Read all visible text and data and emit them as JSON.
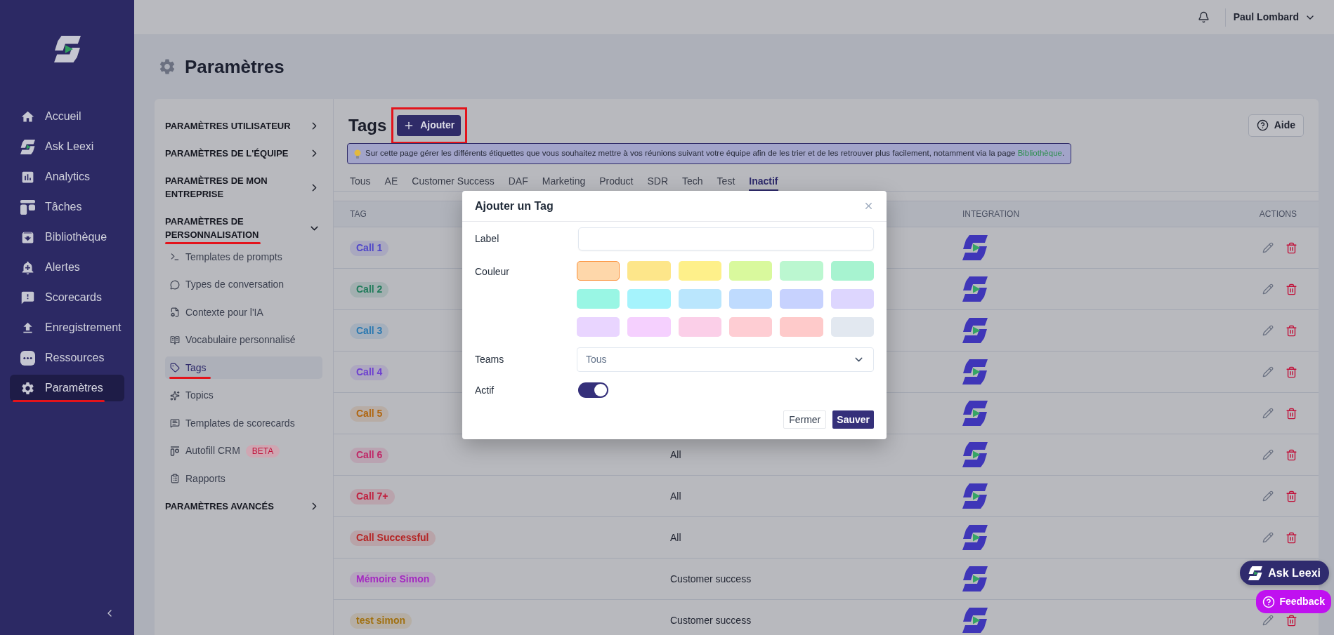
{
  "sidebar": {
    "items": [
      {
        "label": "Accueil",
        "selected": false,
        "highlighted": false
      },
      {
        "label": "Ask Leexi",
        "selected": false,
        "highlighted": false
      },
      {
        "label": "Analytics",
        "selected": false,
        "highlighted": false
      },
      {
        "label": "Tâches",
        "selected": false,
        "highlighted": false
      },
      {
        "label": "Bibliothèque",
        "selected": false,
        "highlighted": false
      },
      {
        "label": "Alertes",
        "selected": false,
        "highlighted": false
      },
      {
        "label": "Scorecards",
        "selected": false,
        "highlighted": false
      },
      {
        "label": "Enregistrement",
        "selected": false,
        "highlighted": false
      },
      {
        "label": "Ressources",
        "selected": false,
        "highlighted": false
      },
      {
        "label": "Paramètres",
        "selected": true,
        "highlighted": true
      }
    ]
  },
  "header": {
    "user_name": "Paul Lombard"
  },
  "page_title": "Paramètres",
  "settings_nav": {
    "sections": [
      {
        "label": "PARAMÈTRES UTILISATEUR",
        "expanded": false,
        "highlighted": false
      },
      {
        "label": "PARAMÈTRES DE L'ÉQUIPE",
        "expanded": false,
        "highlighted": false
      },
      {
        "label": "PARAMÈTRES DE MON ENTREPRISE",
        "expanded": false,
        "highlighted": false
      },
      {
        "label": "PARAMÈTRES DE PERSONNALISATION",
        "expanded": true,
        "highlighted": true,
        "children": [
          {
            "label": "Templates de prompts",
            "selected": false,
            "highlighted": false
          },
          {
            "label": "Types de conversation",
            "selected": false,
            "highlighted": false
          },
          {
            "label": "Contexte pour l'IA",
            "selected": false,
            "highlighted": false
          },
          {
            "label": "Vocabulaire personnalisé",
            "selected": false,
            "highlighted": false
          },
          {
            "label": "Tags",
            "selected": true,
            "highlighted": true
          },
          {
            "label": "Topics",
            "selected": false,
            "highlighted": false
          },
          {
            "label": "Templates de scorecards",
            "selected": false,
            "highlighted": false
          },
          {
            "label": "Autofill CRM",
            "badge": "BETA",
            "selected": false,
            "highlighted": false
          },
          {
            "label": "Rapports",
            "selected": false,
            "highlighted": false
          }
        ]
      },
      {
        "label": "PARAMÈTRES AVANCÉS",
        "expanded": false,
        "highlighted": false
      }
    ]
  },
  "tags_panel": {
    "title": "Tags",
    "add_button": {
      "label": "Ajouter",
      "highlighted": true
    },
    "help_button": "Aide",
    "info_banner": {
      "text": "Sur cette page gérer les différents étiquettes que vous souhaitez mettre à vos réunions suivant votre équipe afin de les trier et de les retrouver plus facilement, notamment via la page ",
      "link": "Bibliothèque",
      "end": "."
    },
    "tabs": [
      {
        "label": "Tous",
        "selected": false
      },
      {
        "label": "AE",
        "selected": false
      },
      {
        "label": "Customer Success",
        "selected": false
      },
      {
        "label": "DAF",
        "selected": false
      },
      {
        "label": "Marketing",
        "selected": false
      },
      {
        "label": "Product",
        "selected": false
      },
      {
        "label": "SDR",
        "selected": false
      },
      {
        "label": "Tech",
        "selected": false
      },
      {
        "label": "Test",
        "selected": false
      },
      {
        "label": "Inactif",
        "selected": true
      }
    ],
    "table": {
      "columns": {
        "tag": "TAG",
        "integration": "INTEGRATION",
        "actions": "ACTIONS"
      },
      "rows": [
        {
          "tag": "Call 1",
          "color": "#4f46c8"
        },
        {
          "tag": "Call 2",
          "color": "#1f7a5a"
        },
        {
          "tag": "Call 3",
          "color": "#2a78b0"
        },
        {
          "tag": "Call 4",
          "color": "#6d3fd0"
        },
        {
          "tag": "Call 5",
          "color": "#b0650f"
        },
        {
          "tag": "Call 6",
          "color": "#c02666",
          "team": "All"
        },
        {
          "tag": "Call 7+",
          "color": "#c0203f",
          "team": "All"
        },
        {
          "tag": "Call Successful",
          "color": "#b52525",
          "team": "All"
        },
        {
          "tag": "Mémoire Simon",
          "color": "#a42ac0",
          "team": "Customer success"
        },
        {
          "tag": "test simon",
          "color": "#a07010",
          "team": "Customer success"
        }
      ]
    }
  },
  "modal": {
    "title": "Ajouter un Tag",
    "fields": [
      {
        "kind": "text",
        "label": "Label"
      },
      {
        "kind": "colors",
        "label": "Couleur",
        "swatches": [
          {
            "color": "#fed7aa",
            "selected": true
          },
          {
            "color": "#fde68a",
            "selected": false
          },
          {
            "color": "#fef08a",
            "selected": false
          },
          {
            "color": "#d9f99d",
            "selected": false
          },
          {
            "color": "#bbf7d0",
            "selected": false
          },
          {
            "color": "#a7f3d0",
            "selected": false
          },
          {
            "color": "#99f6e4",
            "selected": false
          },
          {
            "color": "#a5f3fc",
            "selected": false
          },
          {
            "color": "#bae6fd",
            "selected": false
          },
          {
            "color": "#bfdbfe",
            "selected": false
          },
          {
            "color": "#c7d2fe",
            "selected": false
          },
          {
            "color": "#ddd6fe",
            "selected": false
          },
          {
            "color": "#e9d5ff",
            "selected": false
          },
          {
            "color": "#f5d0fe",
            "selected": false
          },
          {
            "color": "#fbcfe8",
            "selected": false
          },
          {
            "color": "#fecdd3",
            "selected": false
          },
          {
            "color": "#fecaca",
            "selected": false
          },
          {
            "color": "#e2e8f0",
            "selected": false
          }
        ]
      },
      {
        "kind": "select",
        "label": "Teams",
        "value": "Tous"
      },
      {
        "kind": "toggle",
        "label": "Actif",
        "on": true
      }
    ],
    "buttons": [
      {
        "label": "Fermer",
        "kind": "secondary"
      },
      {
        "label": "Sauver",
        "kind": "primary"
      }
    ]
  },
  "floating_buttons": [
    {
      "label": "Ask Leexi",
      "kind": "assistant"
    },
    {
      "label": "Feedback",
      "kind": "feedback"
    }
  ]
}
